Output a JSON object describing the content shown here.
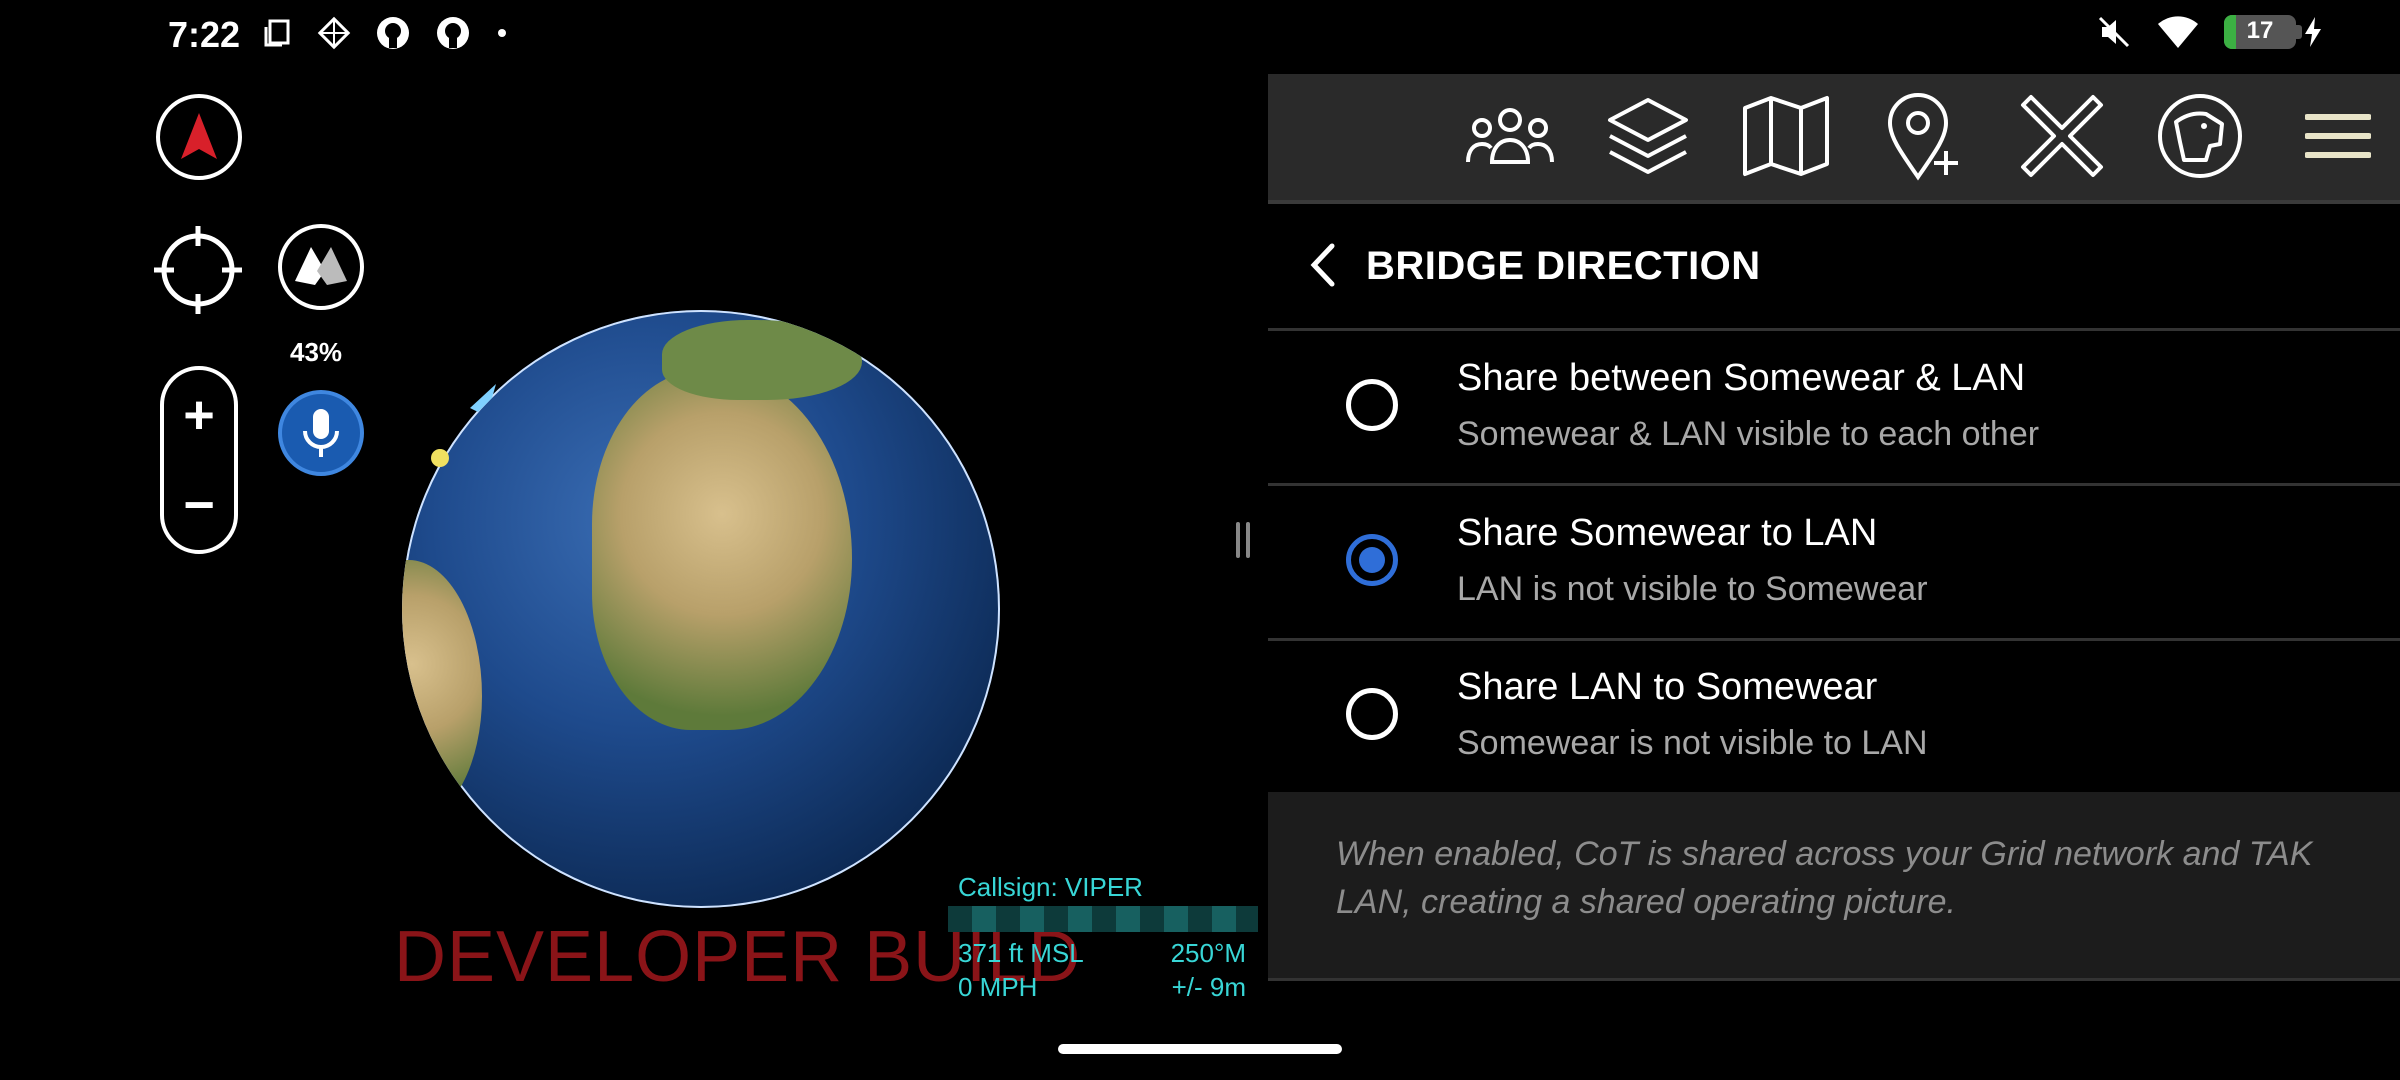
{
  "status_bar": {
    "time": "7:22",
    "left_icons": [
      "copy-icon",
      "diamond-grid-icon",
      "github-icon",
      "github-icon",
      "dot-icon"
    ],
    "right_icons": [
      "mute-icon",
      "wifi-icon",
      "battery-charging-icon"
    ],
    "battery_level": "17"
  },
  "map_controls": {
    "zoom_in": "+",
    "zoom_out": "−",
    "signal_percent": "43%"
  },
  "watermark": "DEVELOPER BUILD",
  "telemetry": {
    "callsign": "Callsign: VIPER",
    "altitude": "371 ft MSL",
    "heading": "250°M",
    "speed": "0 MPH",
    "accuracy": "+/- 9m"
  },
  "toolbar": {
    "icons": [
      "contacts-icon",
      "layers-icon",
      "map-icon",
      "add-pin-icon",
      "tools-icon",
      "dog-icon",
      "hamburger-menu-icon"
    ]
  },
  "panel": {
    "title": "BRIDGE DIRECTION",
    "options": [
      {
        "title": "Share between Somewear & LAN",
        "subtitle": "Somewear & LAN visible to each other",
        "selected": false
      },
      {
        "title": "Share Somewear to LAN",
        "subtitle": "LAN is not visible to Somewear",
        "selected": true
      },
      {
        "title": "Share LAN to Somewear",
        "subtitle": "Somewear is not visible to LAN",
        "selected": false
      }
    ],
    "note": "When enabled, CoT is shared across your Grid network and TAK LAN, creating a shared operating picture."
  },
  "colors": {
    "accent": "#2f6ed8",
    "telemetry": "#38d6d6",
    "watermark": "#8a1418",
    "battery_fill": "#3cb043"
  }
}
